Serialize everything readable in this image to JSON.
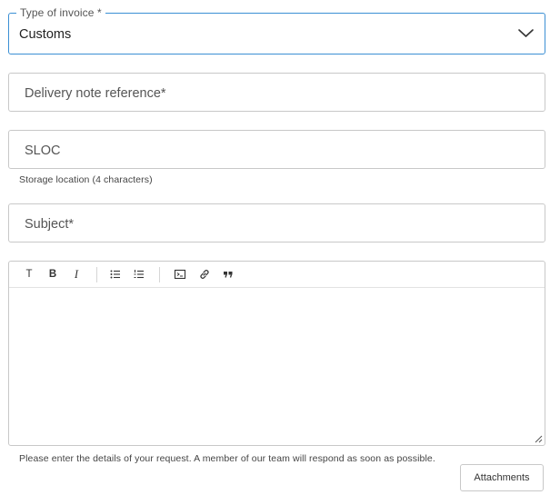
{
  "invoice_type": {
    "label": "Type of invoice",
    "required_mark": "*",
    "selected_value": "Customs",
    "icon": "chevron-down-icon"
  },
  "delivery_note": {
    "placeholder": "Delivery note reference",
    "required_mark": "*"
  },
  "sloc": {
    "placeholder": "SLOC",
    "helper_text": "Storage location (4 characters)"
  },
  "subject": {
    "placeholder": "Subject",
    "required_mark": "*"
  },
  "editor": {
    "toolbar": {
      "text_style_label": "T",
      "bold_label": "B",
      "italic_label": "I",
      "icons": [
        "bulleted-list-icon",
        "numbered-list-icon",
        "code-block-icon",
        "link-icon",
        "quote-icon"
      ]
    },
    "content": "",
    "helper_text": "Please enter the details of your request. A member of our team will respond as soon as possible."
  },
  "attachments_button": {
    "label": "Attachments"
  },
  "colors": {
    "focus_border": "#3b8fd4",
    "default_border": "#c8c8c8",
    "text": "#333333"
  }
}
